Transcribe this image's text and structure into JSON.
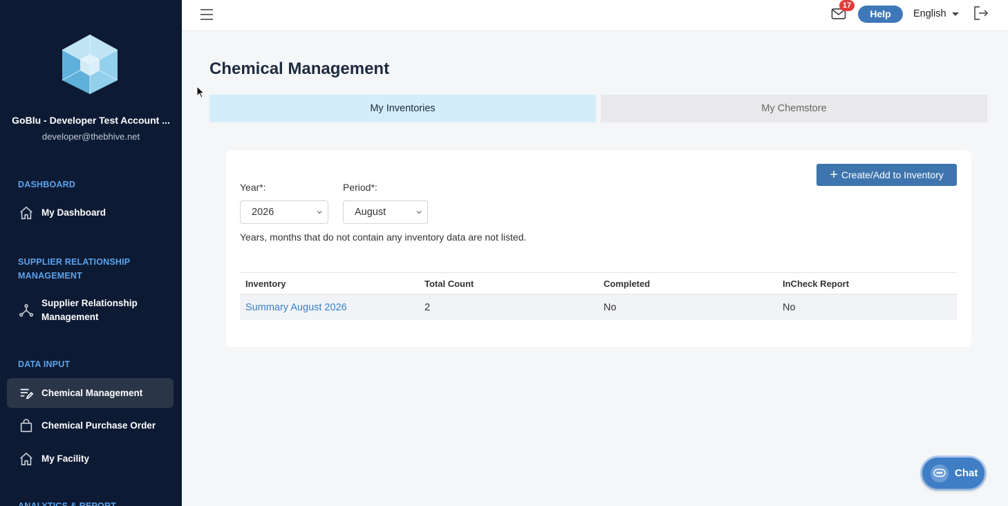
{
  "sidebar": {
    "account_name": "GoBlu - Developer Test Account ...",
    "account_email": "developer@thebhive.net",
    "sections": [
      {
        "heading": "DASHBOARD",
        "items": [
          {
            "label": "My Dashboard",
            "icon": "home-icon"
          }
        ]
      },
      {
        "heading": "SUPPLIER RELATIONSHIP MANAGEMENT",
        "items": [
          {
            "label": "Supplier Relationship Management",
            "icon": "network-icon"
          }
        ]
      },
      {
        "heading": "DATA INPUT",
        "items": [
          {
            "label": "Chemical Management",
            "icon": "edit-list-icon",
            "active": true
          },
          {
            "label": "Chemical Purchase Order",
            "icon": "shopping-bag-icon"
          },
          {
            "label": "My Facility",
            "icon": "home-icon"
          }
        ]
      }
    ],
    "partial_heading": "ANALYTICS & REPORT"
  },
  "topbar": {
    "notification_count": "17",
    "help_label": "Help",
    "language": "English"
  },
  "main": {
    "title": "Chemical Management",
    "tabs": [
      {
        "label": "My Inventories",
        "active": true
      },
      {
        "label": "My Chemstore",
        "active": false
      }
    ],
    "create_button": "Create/Add to Inventory",
    "year_label": "Year*:",
    "year_value": "2026",
    "period_label": "Period*:",
    "period_value": "August",
    "hint": "Years, months that do not contain any inventory data are not listed.",
    "table": {
      "headers": [
        "Inventory",
        "Total Count",
        "Completed",
        "InCheck Report"
      ],
      "rows": [
        [
          "Summary August 2026",
          "2",
          "No",
          "No"
        ]
      ]
    }
  },
  "chat_label": "Chat",
  "colors": {
    "sidebar_bg": "#0d1a33",
    "section_heading": "#5aa4ee",
    "accent": "#3e75ae",
    "active_tab": "#d3eefa",
    "badge": "#e43b3b"
  }
}
